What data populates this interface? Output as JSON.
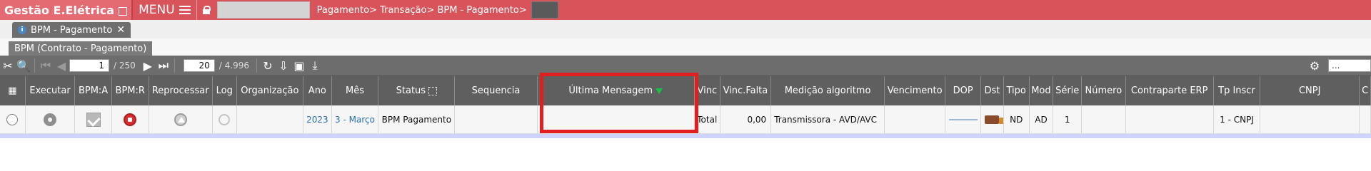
{
  "topbar": {
    "brand": "Gestão E.Elétrica",
    "menu_label": "MENU",
    "breadcrumb": "Pagamento> Transação> BPM - Pagamento>"
  },
  "tabs": [
    {
      "label": "BPM - Pagamento",
      "close": "✕",
      "info": "i"
    }
  ],
  "section": {
    "label": "BPM (Contrato - Pagamento)"
  },
  "toolbar": {
    "page_value": "1",
    "page_total": "/ 250",
    "rows_value": "20",
    "rows_total": "/ 4.996",
    "search_value": "..."
  },
  "table": {
    "columns": [
      "",
      "Executar",
      "BPM:A",
      "BPM:R",
      "Reprocessar",
      "Log",
      "Organização",
      "Ano",
      "Mês",
      "Status",
      "Sequencia",
      "Última Mensagem",
      "Vinc",
      "Vinc.Falta",
      "Medição algoritmo",
      "Vencimento",
      "DOP",
      "Dst",
      "Tipo",
      "Mod",
      "Série",
      "Número",
      "Contraparte ERP",
      "Tp Inscr",
      "CNPJ",
      "C"
    ],
    "row": {
      "ano": "2023",
      "mes": "3 - Março",
      "status": "BPM Pagamento",
      "sequencia": "",
      "ultima_mensagem": "",
      "vinc": "Total",
      "vinc_falta": "0,00",
      "medicao": "Transmissora - AVD/AVC",
      "vencimento": "",
      "tipo": "ND",
      "mod": "AD",
      "serie": "1",
      "numero": "",
      "contraparte": "",
      "tp_inscr": "1 - CNPJ",
      "cnpj": ""
    }
  },
  "colors": {
    "topbar": "#d9535b",
    "toolbar": "#6d6d6d",
    "header": "#5f5f5f",
    "highlight": "#e21f1f",
    "link": "#2e6fb3"
  }
}
